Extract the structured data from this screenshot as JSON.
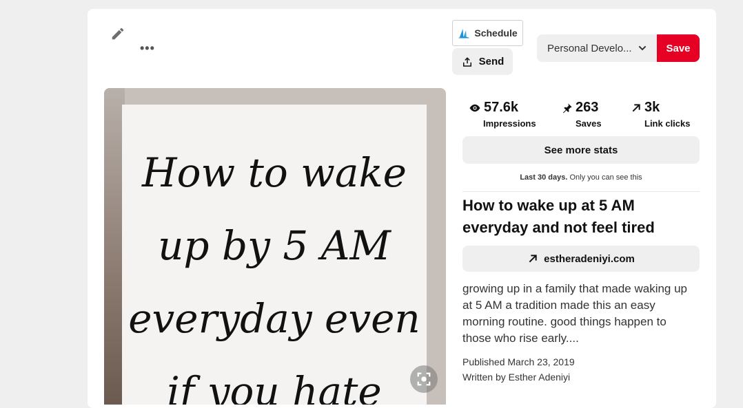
{
  "toolbar": {
    "more_label": "•••",
    "schedule_label": "Schedule",
    "send_label": "Send"
  },
  "board_select": {
    "value": "Personal Develo..."
  },
  "save_label": "Save",
  "pin_image": {
    "text_lines": [
      "How to wake",
      "up by 5 AM",
      "everyday even",
      "if you hate"
    ]
  },
  "stats": [
    {
      "value": "57.6k",
      "label": "Impressions",
      "icon": "eye-icon"
    },
    {
      "value": "263",
      "label": "Saves",
      "icon": "pin-icon"
    },
    {
      "value": "3k",
      "label": "Link clicks",
      "icon": "arrow-up-right-icon"
    }
  ],
  "see_more_stats_label": "See more stats",
  "stats_note": {
    "period": "Last 30 days.",
    "privacy": "Only you can see this"
  },
  "pin": {
    "title": "How to wake up at 5 AM everyday and not feel tired",
    "link": "estheradeniyi.com",
    "description": "growing up in a family that made waking up at 5 AM a tradition made this an easy morning routine. good things happen to those who rise early....",
    "published": "Published March 23, 2019",
    "author": "Written by Esther Adeniyi"
  },
  "colors": {
    "save": "#e60023",
    "button_gray": "#efefef",
    "schedule_logo": "#1e90d6"
  }
}
